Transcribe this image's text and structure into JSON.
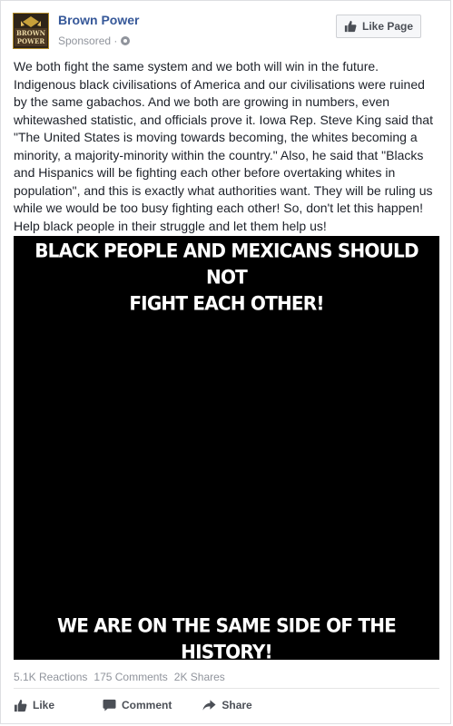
{
  "page": {
    "name": "Brown Power",
    "sponsored": "Sponsored ·",
    "avatar_text": [
      "BROWN",
      "POWER"
    ],
    "like_page_label": "Like Page"
  },
  "post": {
    "text": "We both fight the same system and we both will win in the future. Indigenous black civilisations of America and our civilisations were ruined by the same gabachos. And we both are growing in numbers, even whitewashed statistic, and officials prove it. Iowa Rep. Steve King said that \"The United States is moving towards becoming, the whites becoming a minority, a majority-minority within the country.\" Also, he said that \"Blacks and Hispanics will be fighting each other before overtaking whites in population\", and this is exactly what authorities want. They will be ruling us while we would be too busy fighting each other! So, don't let this happen! Help black people in their struggle and let them help us!",
    "image_top_line1": "BLACK PEOPLE AND MEXICANS SHOULD NOT",
    "image_top_line2": "FIGHT EACH OTHER!",
    "image_bottom": "WE ARE ON THE SAME SIDE OF THE HISTORY!"
  },
  "stats": {
    "reactions": "5.1K Reactions",
    "comments": "175 Comments",
    "shares": "2K Shares"
  },
  "actions": {
    "like": "Like",
    "comment": "Comment",
    "share": "Share"
  },
  "colors": {
    "link": "#365899",
    "muted": "#90949c",
    "action": "#4b4f56",
    "image_bg": "#000000"
  }
}
